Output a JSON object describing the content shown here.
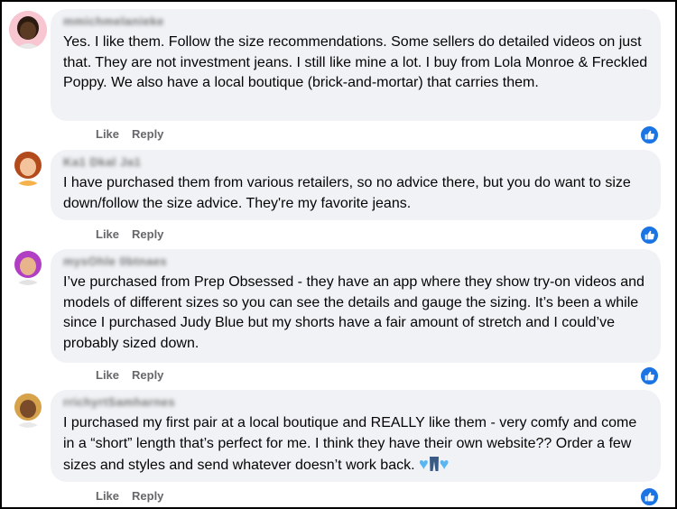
{
  "comments": [
    {
      "author": "mmichmelanieke",
      "avatar_bg": "#f7c6d0",
      "skin": "#5a3a22",
      "hair": "#2a1a10",
      "text": "Yes. I like them. Follow the size recommendations. Some sellers do detailed videos on just that. They are not investment jeans. I still like mine a lot. I buy from Lola Monroe & Freckled Poppy. We also have a local boutique (brick-and-mortar) that carries them.",
      "like_label": "Like",
      "reply_label": "Reply"
    },
    {
      "author": "Ka1 Dkal Ja1",
      "avatar_bg": "#ffffff",
      "skin": "#f3c49b",
      "hair": "#b34a1c",
      "text": "I have purchased them from various retailers, so no advice there, but you do want to size down/follow the size advice. They're my favorite jeans.",
      "like_label": "Like",
      "reply_label": "Reply"
    },
    {
      "author": "mysOhle 0btnaes",
      "avatar_bg": "#ffffff",
      "skin": "#e7b48c",
      "hair": "#b13fc4",
      "text": "I’ve purchased from Prep Obsessed - they have an app where they show try-on videos and models of different sizes so you can see the details and gauge the sizing. It’s been a while since I purchased Judy Blue but my shorts have a fair amount of stretch and I could’ve probably sized down.",
      "like_label": "Like",
      "reply_label": "Reply"
    },
    {
      "author": "rrichyrtSamharnes",
      "avatar_bg": "#ffffff",
      "skin": "#7a4b2a",
      "hair": "#d6a24a",
      "text": "I purchased my first pair at a local boutique and REALLY like them - very comfy and come in a “short” length that’s perfect for me. I think they have their own website?? Order a few sizes and styles and send whatever doesn’t work back.",
      "emoji": [
        "blue-heart",
        "jeans",
        "blue-heart"
      ],
      "like_label": "Like",
      "reply_label": "Reply"
    }
  ],
  "colors": {
    "bubble": "#f0f2f5",
    "action_text": "#65676b",
    "like_blue": "#1b74e4"
  },
  "icons": [
    "thumbs-up-icon",
    "blue-heart-icon",
    "jeans-icon"
  ]
}
